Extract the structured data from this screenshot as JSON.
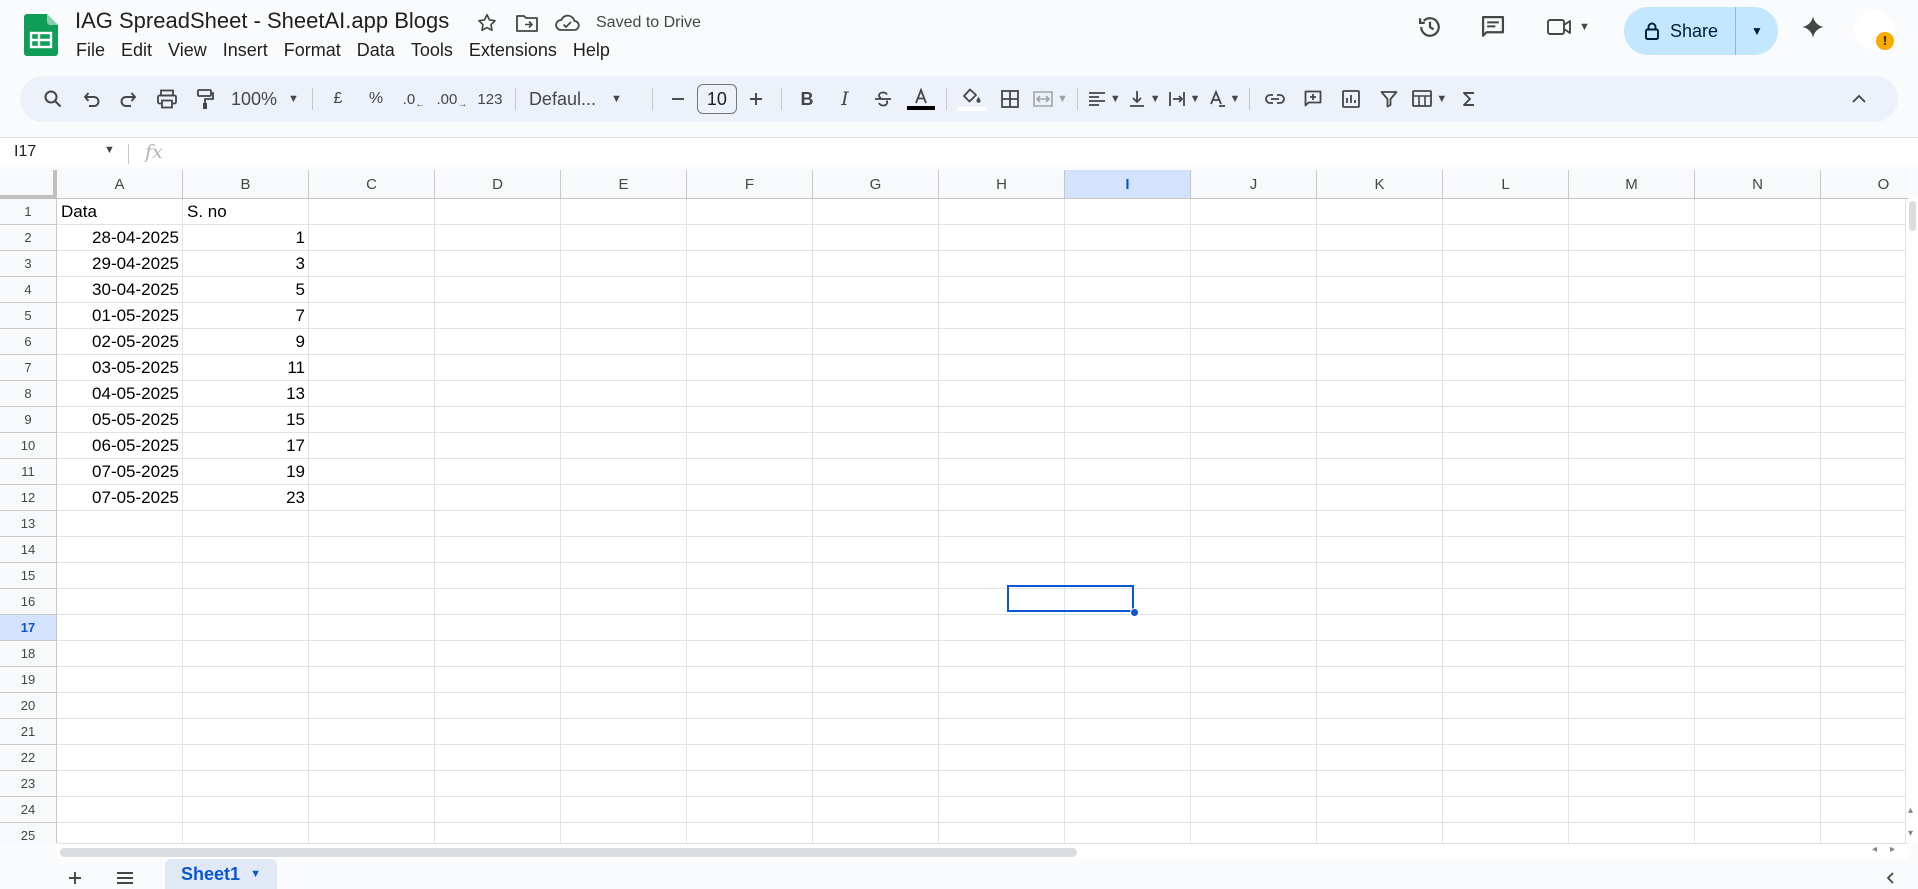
{
  "app": {
    "doc_title": "IAG SpreadSheet - SheetAI.app Blogs",
    "saved_status": "Saved to Drive",
    "menu": [
      "File",
      "Edit",
      "View",
      "Insert",
      "Format",
      "Data",
      "Tools",
      "Extensions",
      "Help"
    ],
    "share_label": "Share",
    "warning_badge": "!"
  },
  "toolbar": {
    "zoom": "100%",
    "currency": "£",
    "percent": "%",
    "decimal_decrease": ".0",
    "decimal_increase": ".00",
    "number_format": "123",
    "font": "Defaul...",
    "font_size": "10"
  },
  "formula_bar": {
    "name_box": "I17",
    "fx": "fx"
  },
  "grid": {
    "columns": [
      "A",
      "B",
      "C",
      "D",
      "E",
      "F",
      "G",
      "H",
      "I",
      "J",
      "K",
      "L",
      "M",
      "N",
      "O"
    ],
    "rows": [
      "1",
      "2",
      "3",
      "4",
      "5",
      "6",
      "7",
      "8",
      "9",
      "10",
      "11",
      "12",
      "13",
      "14",
      "15",
      "16",
      "17",
      "18",
      "19",
      "20",
      "21",
      "22",
      "23",
      "24",
      "25"
    ],
    "selected_column": "I",
    "selected_row": "17",
    "header_row": [
      "Data",
      "S. no"
    ],
    "data": [
      [
        "28-04-2025",
        "1"
      ],
      [
        "29-04-2025",
        "3"
      ],
      [
        "30-04-2025",
        "5"
      ],
      [
        "01-05-2025",
        "7"
      ],
      [
        "02-05-2025",
        "9"
      ],
      [
        "03-05-2025",
        "11"
      ],
      [
        "04-05-2025",
        "13"
      ],
      [
        "05-05-2025",
        "15"
      ],
      [
        "06-05-2025",
        "17"
      ],
      [
        "07-05-2025",
        "19"
      ],
      [
        "07-05-2025",
        "23"
      ]
    ]
  },
  "sheets": {
    "active": "Sheet1"
  },
  "colors": {
    "accent": "#0b57d0",
    "share_bg": "#c2e7ff",
    "selection_header": "#d3e3fd",
    "sheets_green": "#0f9d58"
  }
}
